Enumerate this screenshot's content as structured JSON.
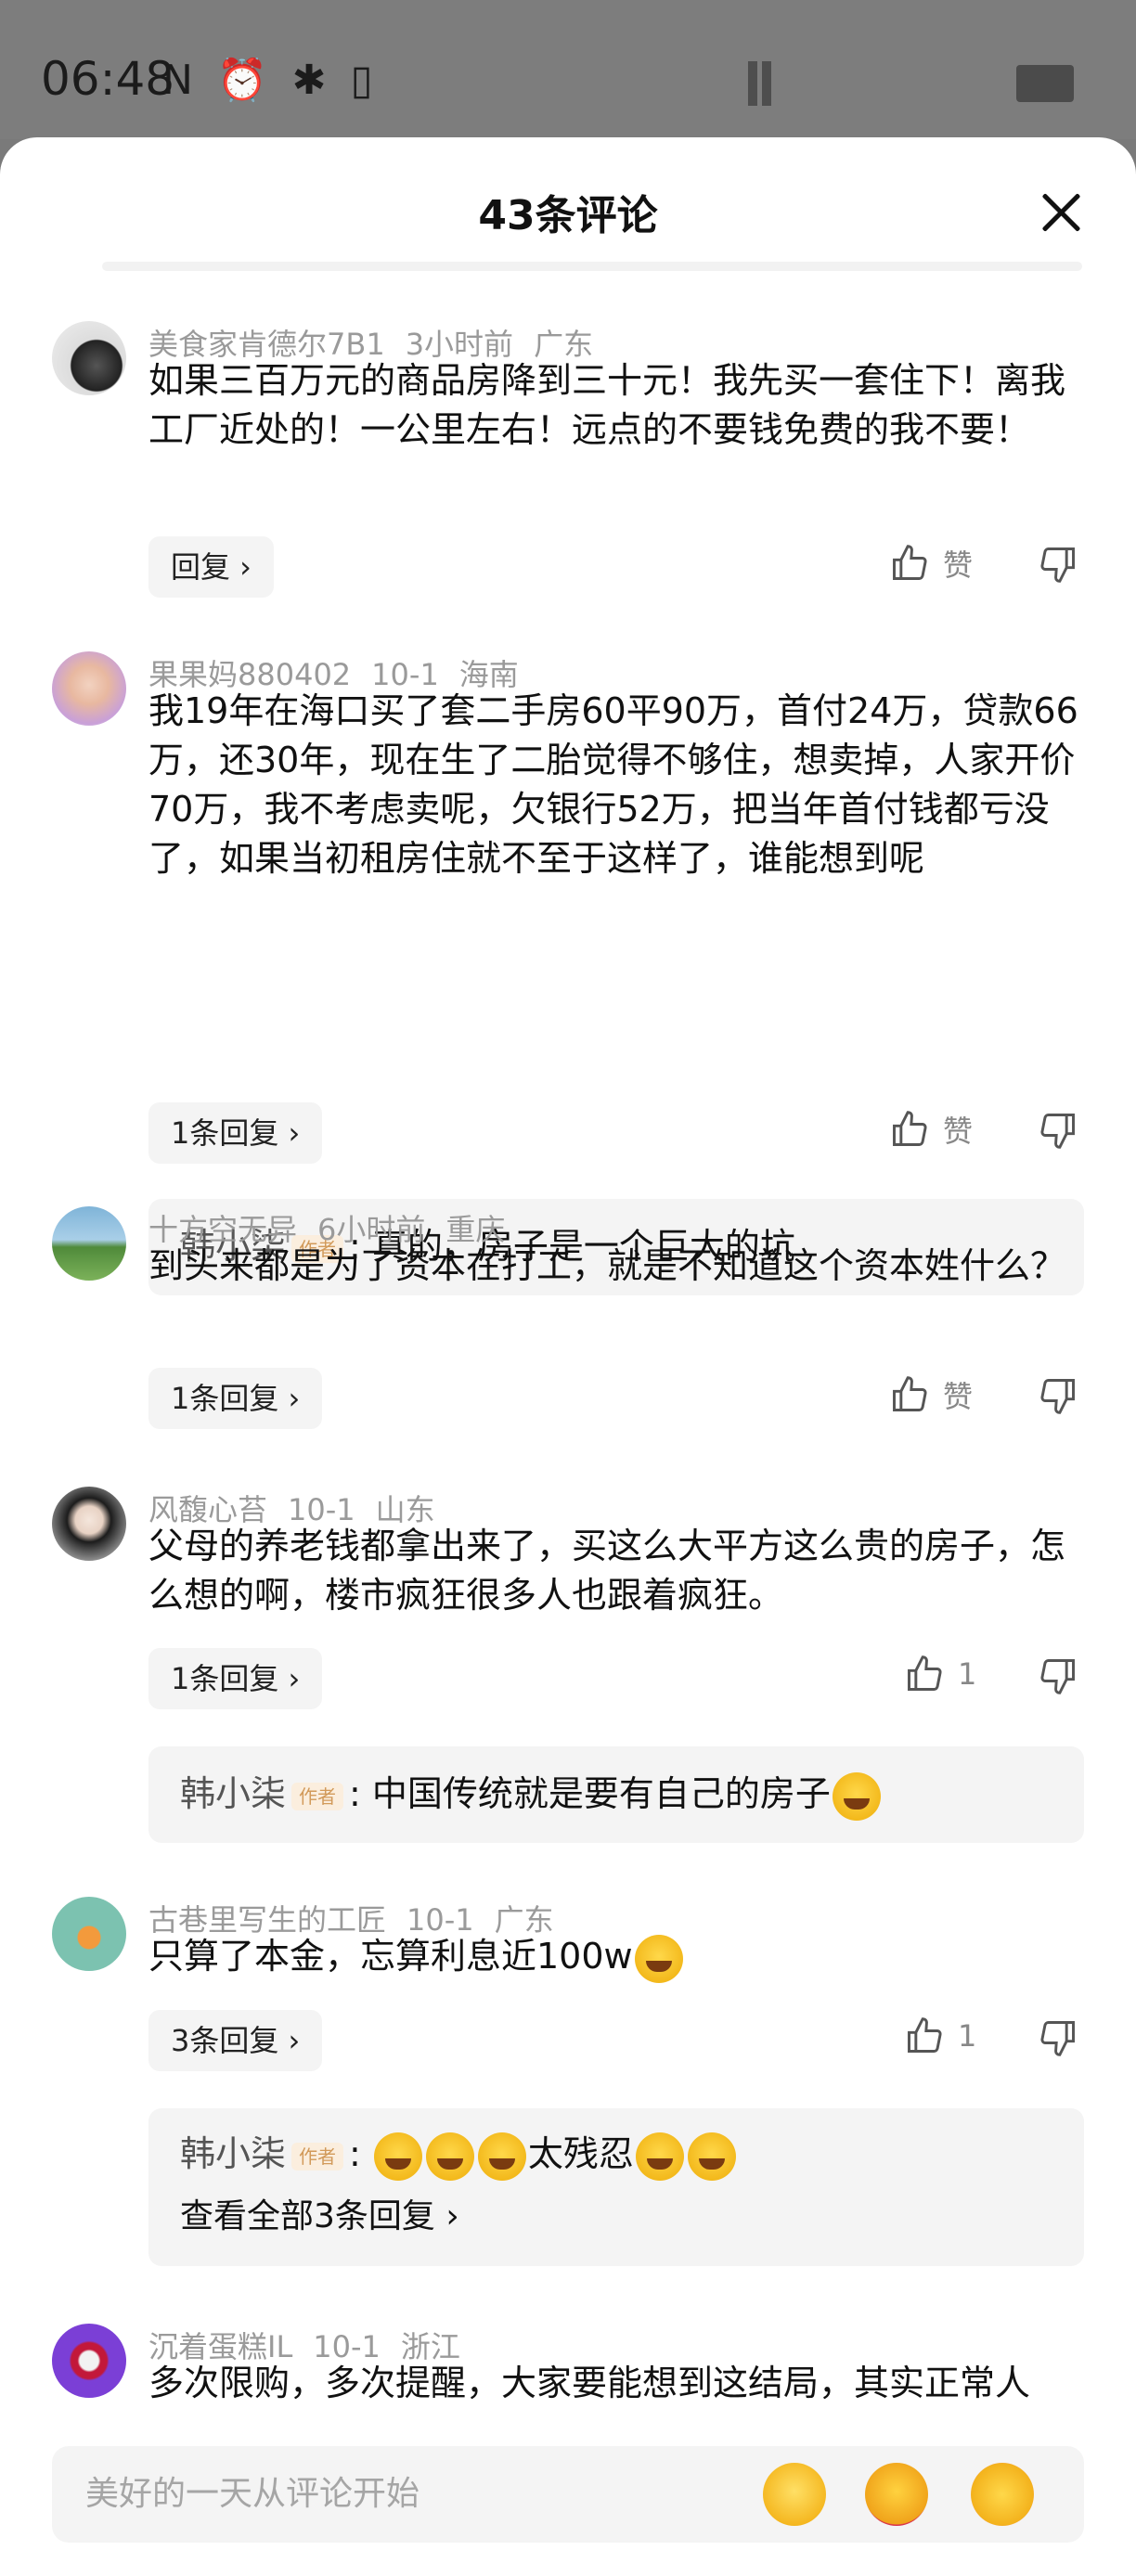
{
  "status": {
    "time": "06:48",
    "icons": "N ⏰ ✱ ▯"
  },
  "header": {
    "title": "43条评论"
  },
  "comments": [
    {
      "user": "美食家肯德尔7B1",
      "time": "3小时前",
      "region": "广东",
      "text": "如果三百万元的商品房降到三十元！我先买一套住下！离我工厂近处的！一公里左右！远点的不要钱免费的我不要！",
      "reply_label": "回复 ›",
      "like_label": "赞"
    },
    {
      "user": "果果妈880402",
      "time": "10-1",
      "region": "海南",
      "text": "我19年在海口买了套二手房60平90万，首付24万，贷款66万，还30年，现在生了二胎觉得不够住，想卖掉，人家开价70万，我不考虑卖呢，欠银行52万，把当年首付钱都亏没了，如果当初租房住就不至于这样了，谁能想到呢",
      "reply_label": "1条回复 ›",
      "like_label": "赞",
      "sub": {
        "name": "韩小柒",
        "tag": "作者",
        "text": ": 真的，房子是一个巨大的坑"
      }
    },
    {
      "user": "十方空无异",
      "time": "6小时前",
      "region": "重庆",
      "text": "到头来都是为了资本在打工，就是不知道这个资本姓什么？",
      "reply_label": "1条回复 ›",
      "like_label": "赞"
    },
    {
      "user": "风馥心苔",
      "time": "10-1",
      "region": "山东",
      "text": "父母的养老钱都拿出来了，买这么大平方这么贵的房子，怎么想的啊，楼市疯狂很多人也跟着疯狂。",
      "reply_label": "1条回复 ›",
      "like_label": "1",
      "sub": {
        "name": "韩小柒",
        "tag": "作者",
        "text": ": 中国传统就是要有自己的房子"
      }
    },
    {
      "user": "古巷里写生的工匠",
      "time": "10-1",
      "region": "广东",
      "text": "只算了本金，忘算利息近100w",
      "reply_label": "3条回复 ›",
      "like_label": "1",
      "sub": {
        "name": "韩小柒",
        "tag": "作者",
        "text": ":",
        "tail": "太残忍",
        "view_all": "查看全部3条回复 ›"
      }
    },
    {
      "user": "沉着蛋糕IL",
      "time": "10-1",
      "region": "浙江",
      "text": "多次限购，多次提醒，大家要能想到这结局，其实正常人"
    }
  ],
  "input": {
    "placeholder": "美好的一天从评论开始"
  },
  "icons": {
    "close": "close-icon",
    "like": "thumb-up-icon",
    "dislike": "thumb-down-icon"
  }
}
